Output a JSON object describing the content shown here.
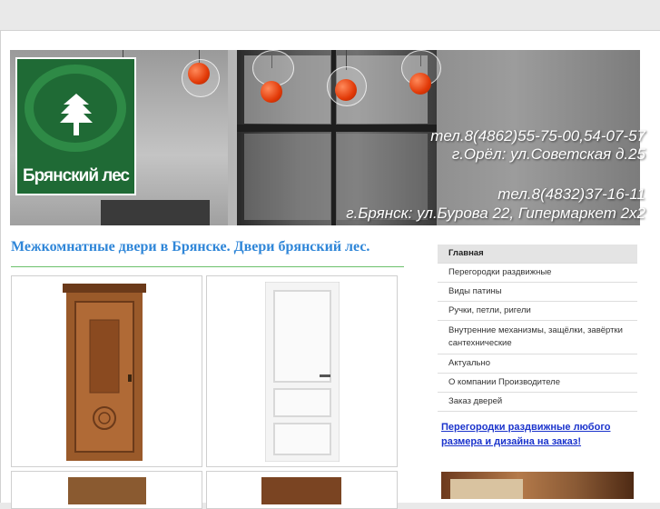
{
  "banner": {
    "logo_text": "Брянский лес",
    "contacts": [
      "тел.8(4862)55-75-00,54-07-57",
      "г.Орёл: ул.Советская д.25",
      "тел.8(4832)37-16-11",
      "г.Брянск: ул.Бурова 22, Гипермаркет 2х2"
    ]
  },
  "main": {
    "title": "Межкомнатные двери в Брянске. Двери брянский лес."
  },
  "sidebar": {
    "items": [
      {
        "label": "Главная",
        "active": true
      },
      {
        "label": "Перегородки раздвижные"
      },
      {
        "label": "Виды патины"
      },
      {
        "label": "Ручки, петли, ригели"
      },
      {
        "label": "Внутренние механизмы, защёлки, завёртки сантехнические"
      },
      {
        "label": "Актуально"
      },
      {
        "label": "О компании Производителе"
      },
      {
        "label": "Заказ дверей"
      }
    ],
    "promo_link": "Перегородки раздвижные любого размера и дизайна на заказ!"
  },
  "colors": {
    "title": "#2f86d8",
    "title_rule": "#6cc06c",
    "logo_bg": "#1f6a35",
    "promo_link": "#1a33cc"
  }
}
